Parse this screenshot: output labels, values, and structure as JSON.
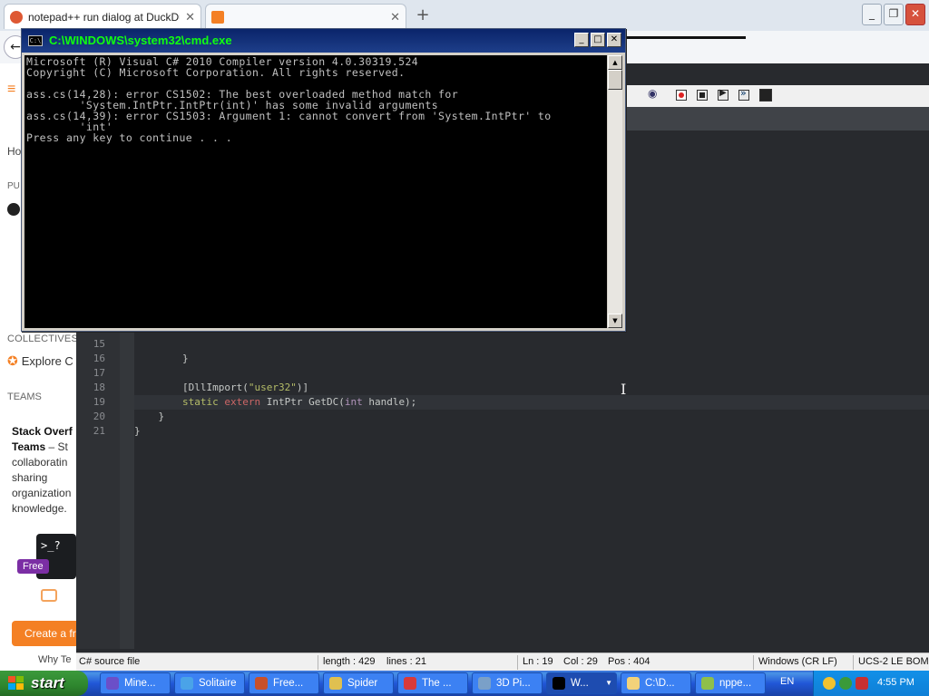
{
  "browser": {
    "tabs": [
      {
        "label": "notepad++ run dialog at DuckDuc",
        "close": "✕"
      },
      {
        "label": "",
        "close": "✕"
      }
    ],
    "new_tab": "+",
    "window_buttons": {
      "minimize": "_",
      "maximize": "❐",
      "close": "✕"
    },
    "back": "←"
  },
  "so_sidebar": {
    "home_partial": "Ho",
    "public_partial": "PU",
    "collectives": "COLLECTIVES",
    "explore": "Explore C",
    "teams": "TEAMS",
    "teams_title": "Stack Overf",
    "teams_sub_bold": "Teams",
    "teams_sub_rest": " – St",
    "teams_body": [
      "collaboratin",
      "sharing",
      "organization",
      "knowledge."
    ],
    "terminal_prompt": ">_?",
    "free_badge": "Free",
    "create_btn": "Create a fr",
    "why": "Why Te"
  },
  "editor": {
    "lines": [
      {
        "n": "15",
        "segments": [
          {
            "t": "                ",
            "c": "plain"
          }
        ]
      },
      {
        "n": "16",
        "segments": [
          {
            "t": "        }",
            "c": "plain"
          }
        ]
      },
      {
        "n": "17",
        "segments": [
          {
            "t": "",
            "c": "plain"
          }
        ]
      },
      {
        "n": "18",
        "segments": [
          {
            "t": "        [DllImport(",
            "c": "plain"
          },
          {
            "t": "\"user32\"",
            "c": "str"
          },
          {
            "t": ")]",
            "c": "plain"
          }
        ]
      },
      {
        "n": "19",
        "segments": [
          {
            "t": "        ",
            "c": "plain"
          },
          {
            "t": "static",
            "c": "str"
          },
          {
            "t": " ",
            "c": "plain"
          },
          {
            "t": "extern",
            "c": "kw2"
          },
          {
            "t": " IntPtr GetDC(",
            "c": "plain"
          },
          {
            "t": "int",
            "c": "kw"
          },
          {
            "t": " handle);",
            "c": "plain"
          }
        ]
      },
      {
        "n": "20",
        "segments": [
          {
            "t": "    }",
            "c": "plain"
          }
        ]
      },
      {
        "n": "21",
        "segments": [
          {
            "t": "}",
            "c": "plain"
          }
        ]
      }
    ],
    "status": {
      "file_type": "C# source file",
      "length": "length : 429",
      "lines": "lines : 21",
      "ln": "Ln : 19",
      "col": "Col : 29",
      "pos": "Pos : 404",
      "eol": "Windows (CR LF)",
      "encoding": "UCS-2 LE BOM"
    }
  },
  "cmd": {
    "title": "C:\\WINDOWS\\system32\\cmd.exe",
    "icon_text": "C:\\",
    "buttons": {
      "minimize": "_",
      "maximize": "□",
      "close": "✕"
    },
    "lines": [
      "Microsoft (R) Visual C# 2010 Compiler version 4.0.30319.524",
      "Copyright (C) Microsoft Corporation. All rights reserved.",
      "",
      "ass.cs(14,28): error CS1502: The best overloaded method match for",
      "        'System.IntPtr.IntPtr(int)' has some invalid arguments",
      "ass.cs(14,39): error CS1503: Argument 1: cannot convert from 'System.IntPtr' to",
      "        'int'",
      "Press any key to continue . . ."
    ]
  },
  "taskbar": {
    "start": "start",
    "items": [
      {
        "label": "Mine...",
        "icon_color": "#6b4fc8"
      },
      {
        "label": "Solitaire",
        "icon_color": "#4aa3e8"
      },
      {
        "label": "Free...",
        "icon_color": "#c8502a"
      },
      {
        "label": "Spider",
        "icon_color": "#e0c050"
      },
      {
        "label": "The ...",
        "icon_color": "#d83a3a"
      },
      {
        "label": "3D Pi...",
        "icon_color": "#7aa0c8"
      },
      {
        "label": "W...",
        "icon_color": "#000000"
      },
      {
        "label": "C:\\D...",
        "icon_color": "#f2d27a"
      },
      {
        "label": "nppe...",
        "icon_color": "#8fbf4a"
      }
    ],
    "language": "EN",
    "clock": "4:55 PM"
  }
}
